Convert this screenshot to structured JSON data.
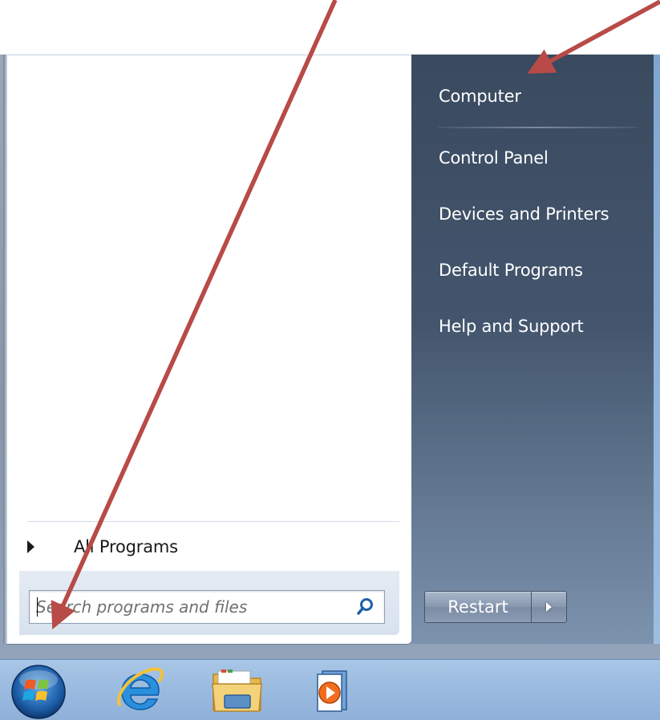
{
  "start_menu": {
    "all_programs_label": "All Programs",
    "search": {
      "placeholder": "Search programs and files",
      "icon": "search-icon"
    },
    "right_items": [
      {
        "label": "Computer"
      },
      {
        "label": "Control Panel"
      },
      {
        "label": "Devices and Printers"
      },
      {
        "label": "Default Programs"
      },
      {
        "label": "Help and Support"
      }
    ],
    "shutdown": {
      "label": "Restart",
      "options_icon": "chevron-right-icon"
    }
  },
  "taskbar": {
    "items": [
      {
        "name": "start-button",
        "icon": "windows-logo-icon"
      },
      {
        "name": "internet-explorer",
        "icon": "internet-explorer-icon"
      },
      {
        "name": "windows-explorer",
        "icon": "folder-icon"
      },
      {
        "name": "media-player",
        "icon": "media-player-icon"
      }
    ]
  },
  "annotations": {
    "arrow_color": "#b84a47"
  },
  "colors": {
    "right_pane_top": "#3a4a5f",
    "right_pane_bottom": "#7c93ae",
    "taskbar": "#9bbbe0"
  }
}
